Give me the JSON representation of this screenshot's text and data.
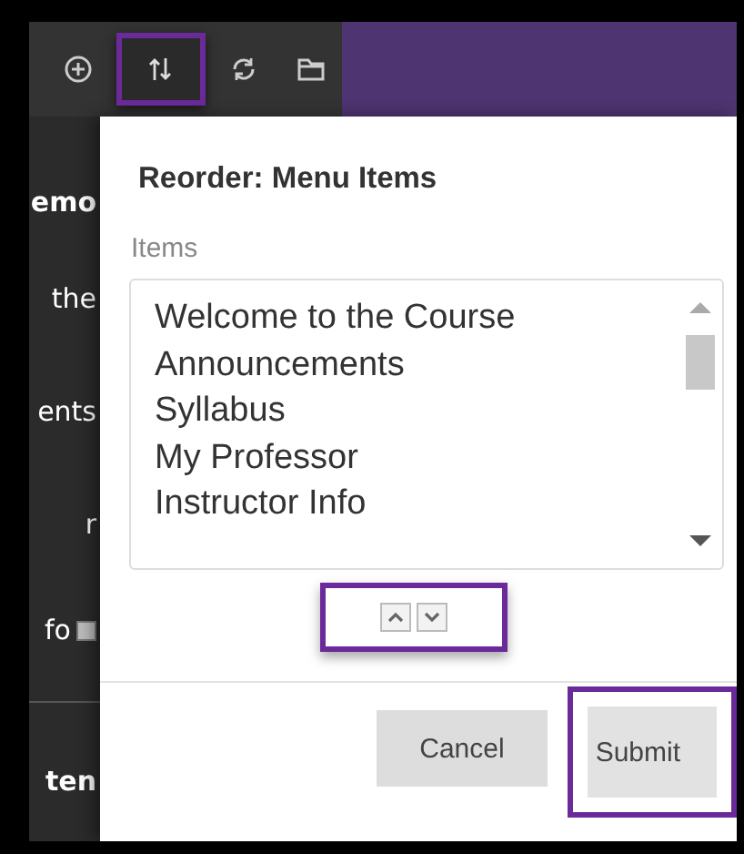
{
  "toolbar": {
    "tools": [
      {
        "kind": "add",
        "highlighted": false
      },
      {
        "kind": "reorder",
        "highlighted": true
      },
      {
        "kind": "refresh",
        "highlighted": false
      },
      {
        "kind": "folder",
        "highlighted": false
      }
    ]
  },
  "sidebar": {
    "items": [
      {
        "label": "emo",
        "bold": true
      },
      {
        "label": "the",
        "bold": false
      },
      {
        "label": "ents",
        "bold": false
      },
      {
        "label": "r",
        "bold": false
      },
      {
        "label": "fo",
        "bold": false,
        "badge": true
      },
      {
        "label": "ten",
        "bold": true
      }
    ]
  },
  "dialog": {
    "title": "Reorder: Menu Items",
    "list_label": "Items",
    "items": [
      "Welcome to the Course",
      "Announcements",
      "Syllabus",
      "My Professor",
      "Instructor Info"
    ],
    "move_buttons": {
      "highlighted": true
    },
    "buttons": [
      {
        "label": "Cancel",
        "highlighted": false
      },
      {
        "label": "Submit",
        "highlighted": true
      }
    ]
  }
}
